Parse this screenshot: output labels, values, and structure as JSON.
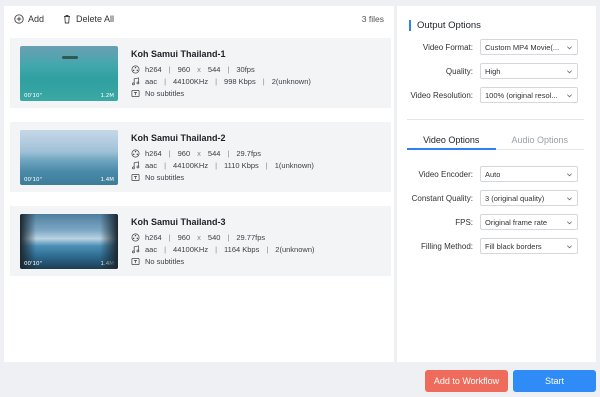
{
  "toolbar": {
    "add_label": "Add",
    "delete_all_label": "Delete All",
    "file_count": "3 files"
  },
  "files": [
    {
      "title": "Koh Samui Thailand-1",
      "codec": "h264",
      "width": "960",
      "x": "x",
      "height": "544",
      "fps": "30fps",
      "audio_codec": "aac",
      "sample_rate": "44100KHz",
      "bitrate": "998 Kbps",
      "channels": "2(unknown)",
      "subtitles": "No subtitles",
      "duration": "00'10\"",
      "size": "1.2M"
    },
    {
      "title": "Koh Samui Thailand-2",
      "codec": "h264",
      "width": "960",
      "x": "x",
      "height": "544",
      "fps": "29.7fps",
      "audio_codec": "aac",
      "sample_rate": "44100KHz",
      "bitrate": "1110 Kbps",
      "channels": "1(unknown)",
      "subtitles": "No subtitles",
      "duration": "00'10\"",
      "size": "1.4M"
    },
    {
      "title": "Koh Samui Thailand-3",
      "codec": "h264",
      "width": "960",
      "x": "x",
      "height": "540",
      "fps": "29.77fps",
      "audio_codec": "aac",
      "sample_rate": "44100KHz",
      "bitrate": "1164 Kbps",
      "channels": "2(unknown)",
      "subtitles": "No subtitles",
      "duration": "00'10\"",
      "size": "1.4M"
    }
  ],
  "output": {
    "title": "Output Options",
    "format_label": "Video Format:",
    "format_value": "Custom MP4 Movie(...",
    "quality_label": "Quality:",
    "quality_value": "High",
    "resolution_label": "Video Resolution:",
    "resolution_value": "100% (original resol..."
  },
  "tabs": {
    "video": "Video Options",
    "audio": "Audio Options"
  },
  "video_options": {
    "encoder_label": "Video Encoder:",
    "encoder_value": "Auto",
    "cq_label": "Constant Quality:",
    "cq_value": "3 (original quality)",
    "fps_label": "FPS:",
    "fps_value": "Original frame rate",
    "fill_label": "Filling Method:",
    "fill_value": "Fill black borders"
  },
  "buttons": {
    "workflow": "Add to Workflow",
    "start": "Start"
  },
  "colors": {
    "accent": "#2f8bf5",
    "workflow": "#ef6b5b"
  }
}
